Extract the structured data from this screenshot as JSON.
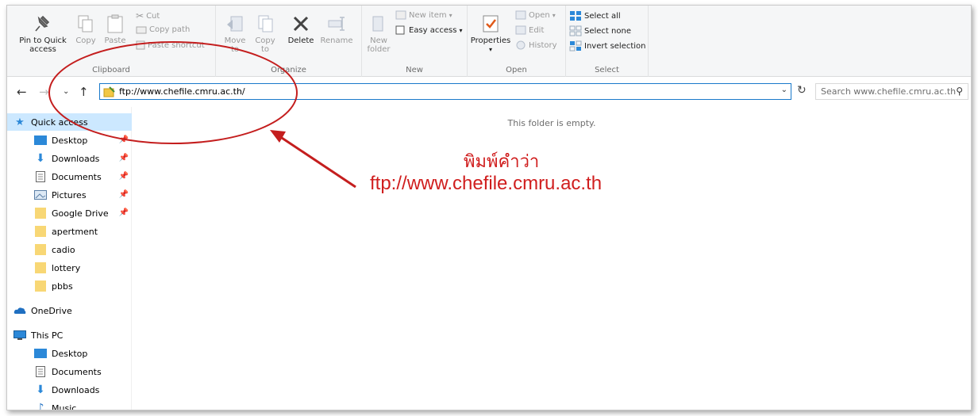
{
  "ribbon": {
    "clipboard": {
      "label": "Clipboard",
      "pin_line1": "Pin to Quick",
      "pin_line2": "access",
      "copy": "Copy",
      "paste": "Paste",
      "cut": "Cut",
      "copy_path": "Copy path",
      "paste_shortcut": "Paste shortcut"
    },
    "organize": {
      "label": "Organize",
      "move_line1": "Move",
      "move_line2": "to",
      "copy_line1": "Copy",
      "copy_line2": "to",
      "delete": "Delete",
      "rename": "Rename"
    },
    "new": {
      "label": "New",
      "new_folder_line1": "New",
      "new_folder_line2": "folder",
      "new_item": "New item",
      "easy_access": "Easy access"
    },
    "open": {
      "label": "Open",
      "properties": "Properties",
      "open": "Open",
      "edit": "Edit",
      "history": "History"
    },
    "select": {
      "label": "Select",
      "select_all": "Select all",
      "select_none": "Select none",
      "invert_selection": "Invert selection"
    }
  },
  "address": {
    "path": "ftp://www.chefile.cmru.ac.th/",
    "search_placeholder": "Search www.chefile.cmru.ac.th"
  },
  "sidebar": {
    "items": [
      {
        "label": "Quick access",
        "icon": "star-icon",
        "selected": true
      },
      {
        "label": "Desktop",
        "icon": "desktop-icon",
        "pinned": true
      },
      {
        "label": "Downloads",
        "icon": "download-icon",
        "pinned": true
      },
      {
        "label": "Documents",
        "icon": "document-icon",
        "pinned": true
      },
      {
        "label": "Pictures",
        "icon": "pictures-icon",
        "pinned": true
      },
      {
        "label": "Google Drive",
        "icon": "folder-icon",
        "pinned": true
      },
      {
        "label": "apertment",
        "icon": "folder-icon"
      },
      {
        "label": "cadio",
        "icon": "folder-icon"
      },
      {
        "label": "lottery",
        "icon": "folder-icon"
      },
      {
        "label": "pbbs",
        "icon": "folder-icon"
      },
      {
        "label": "OneDrive",
        "icon": "cloud-icon"
      },
      {
        "label": "This PC",
        "icon": "computer-icon"
      },
      {
        "label": "Desktop",
        "icon": "desktop-icon"
      },
      {
        "label": "Documents",
        "icon": "document-icon"
      },
      {
        "label": "Downloads",
        "icon": "download-icon"
      },
      {
        "label": "Music",
        "icon": "music-icon"
      }
    ]
  },
  "content": {
    "empty_message": "This folder is empty."
  },
  "annotation": {
    "thai_text": "พิมพ์คำว่า",
    "url_text": "ftp://www.chefile.cmru.ac.th",
    "color": "#d01e1e"
  }
}
